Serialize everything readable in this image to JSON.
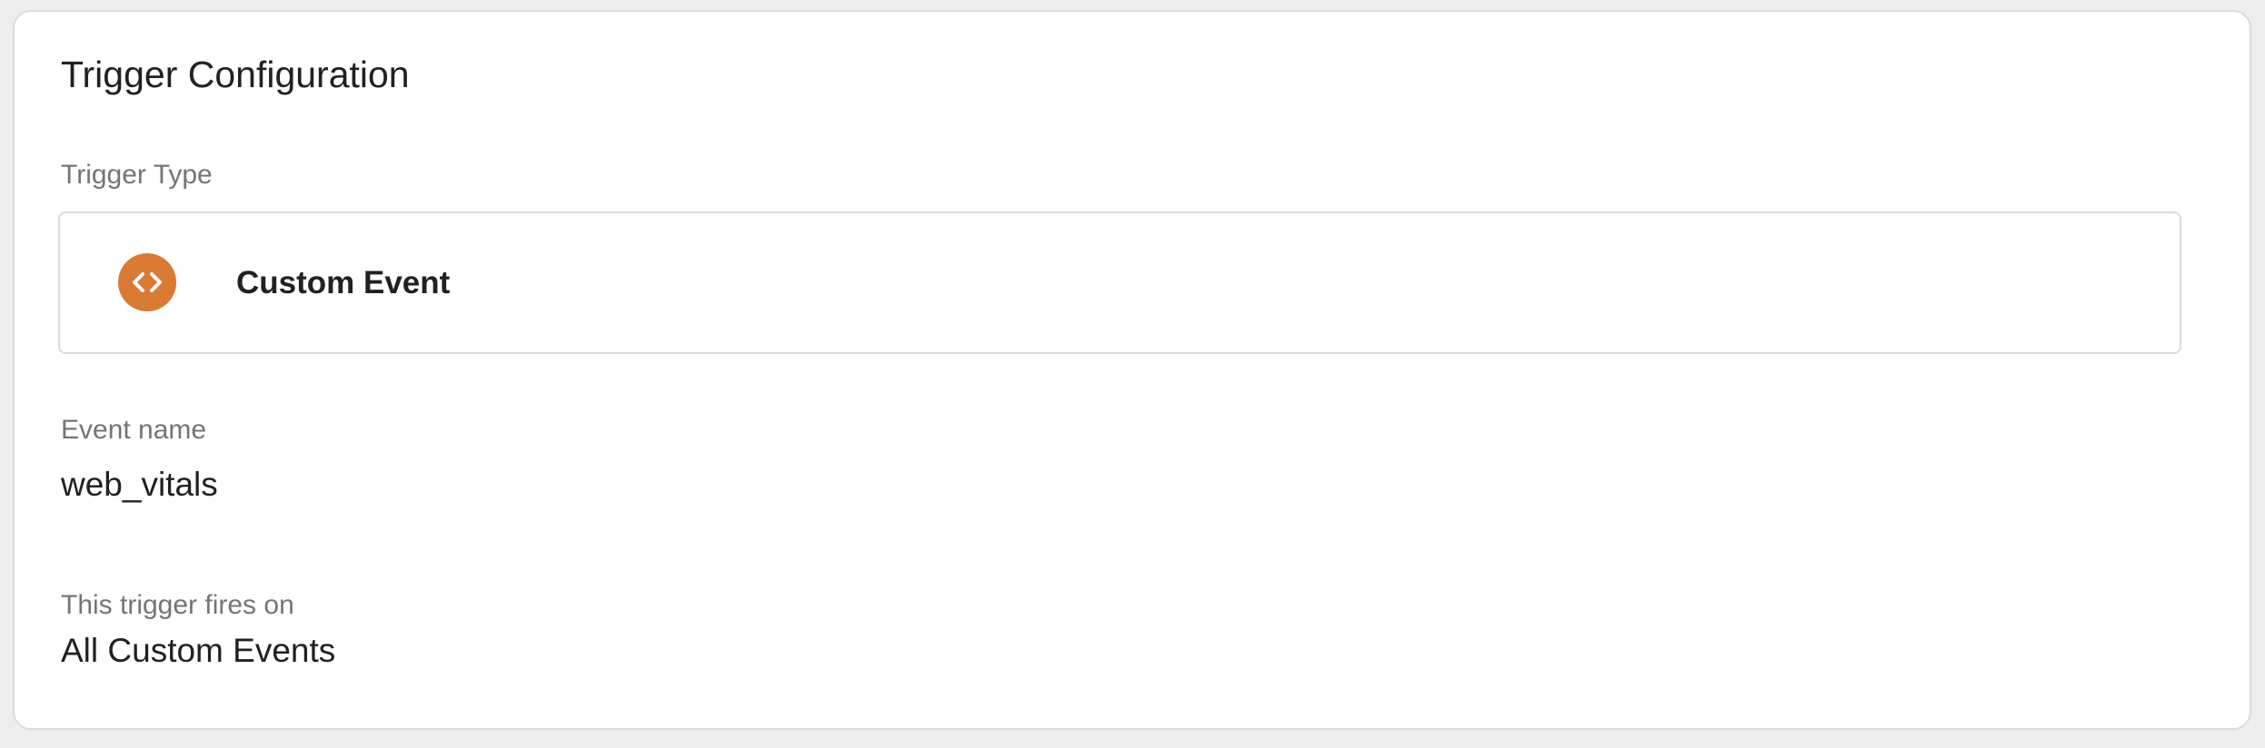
{
  "card": {
    "title": "Trigger Configuration"
  },
  "trigger_type": {
    "label": "Trigger Type",
    "name": "Custom Event",
    "icon": "code-brackets-icon",
    "icon_color": "#d97a35"
  },
  "event_name": {
    "label": "Event name",
    "value": "web_vitals"
  },
  "fires_on": {
    "label": "This trigger fires on",
    "value": "All Custom Events"
  }
}
